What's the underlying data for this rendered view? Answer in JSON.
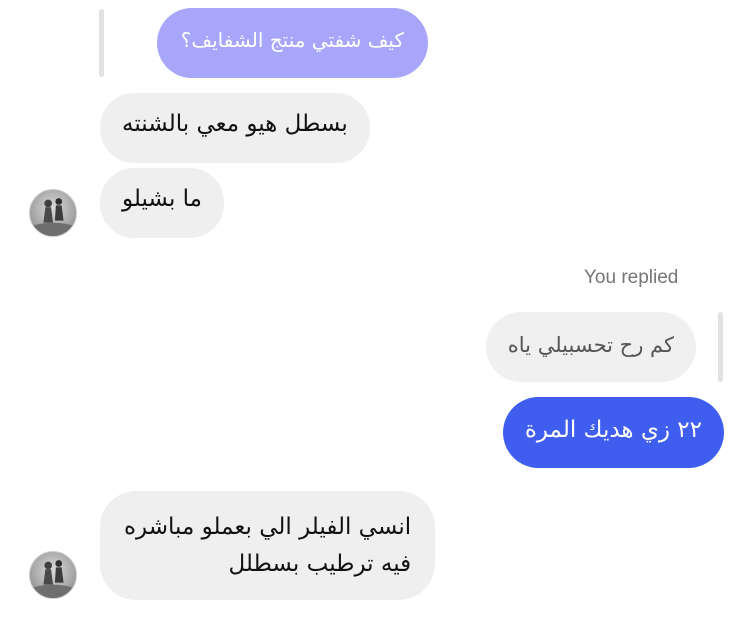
{
  "messages": {
    "quoted_incoming": "كيف شفتي منتج الشفايف؟",
    "incoming_1": "بسطل هيو معي بالشنته",
    "incoming_2": "ما بشيلو",
    "you_replied_label": "You replied",
    "quoted_outgoing": "كم رح تحسبيلي ياه",
    "outgoing_1": "٢٢ زي هديك المرة",
    "incoming_3_line1": "انسي الفيلر الي بعملو مباشره",
    "incoming_3_line2": "فيه ترطيب بسطلل"
  },
  "colors": {
    "incoming_bubble": "#efefef",
    "quoted_purple_bubble": "#a7a6fa",
    "outgoing_bubble": "#3f5ef0",
    "quote_bar": "#e2e2e4"
  },
  "icons": {
    "avatar": "contact-avatar"
  }
}
